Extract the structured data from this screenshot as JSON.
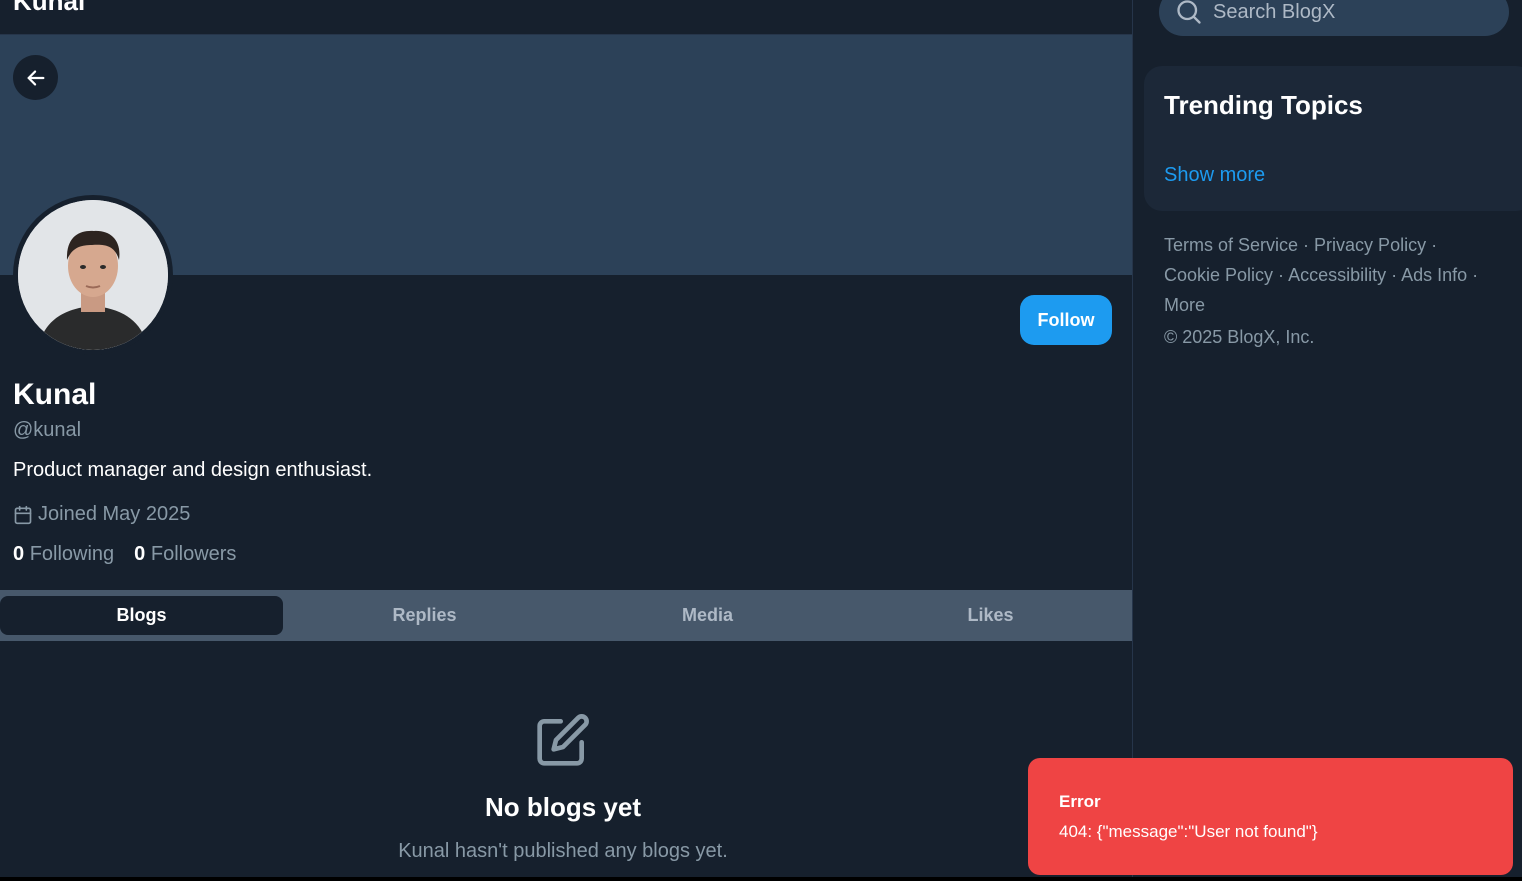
{
  "header": {
    "title": "Kunal"
  },
  "profile": {
    "name": "Kunal",
    "handle": "@kunal",
    "bio": "Product manager and design enthusiast.",
    "joined": "Joined May 2025",
    "following_count": "0",
    "following_label": "Following",
    "followers_count": "0",
    "followers_label": "Followers",
    "follow_label": "Follow"
  },
  "tabs": [
    {
      "label": "Blogs",
      "active": true
    },
    {
      "label": "Replies",
      "active": false
    },
    {
      "label": "Media",
      "active": false
    },
    {
      "label": "Likes",
      "active": false
    }
  ],
  "empty_state": {
    "icon": "edit-icon",
    "title": "No blogs yet",
    "subtitle": "Kunal hasn't published any blogs yet."
  },
  "sidebar": {
    "search_placeholder": "Search BlogX",
    "trending_title": "Trending Topics",
    "show_more": "Show more",
    "links": [
      "Terms of Service",
      "Privacy Policy",
      "Cookie Policy",
      "Accessibility",
      "Ads Info",
      "More"
    ],
    "copyright": "© 2025 BlogX, Inc."
  },
  "toast": {
    "title": "Error",
    "message": "404: {\"message\":\"User not found\"}"
  },
  "colors": {
    "background": "#16202d",
    "banner": "#2c4158",
    "accent": "#1d9bf0",
    "error": "#ef4444",
    "muted_text": "#8899a6"
  }
}
